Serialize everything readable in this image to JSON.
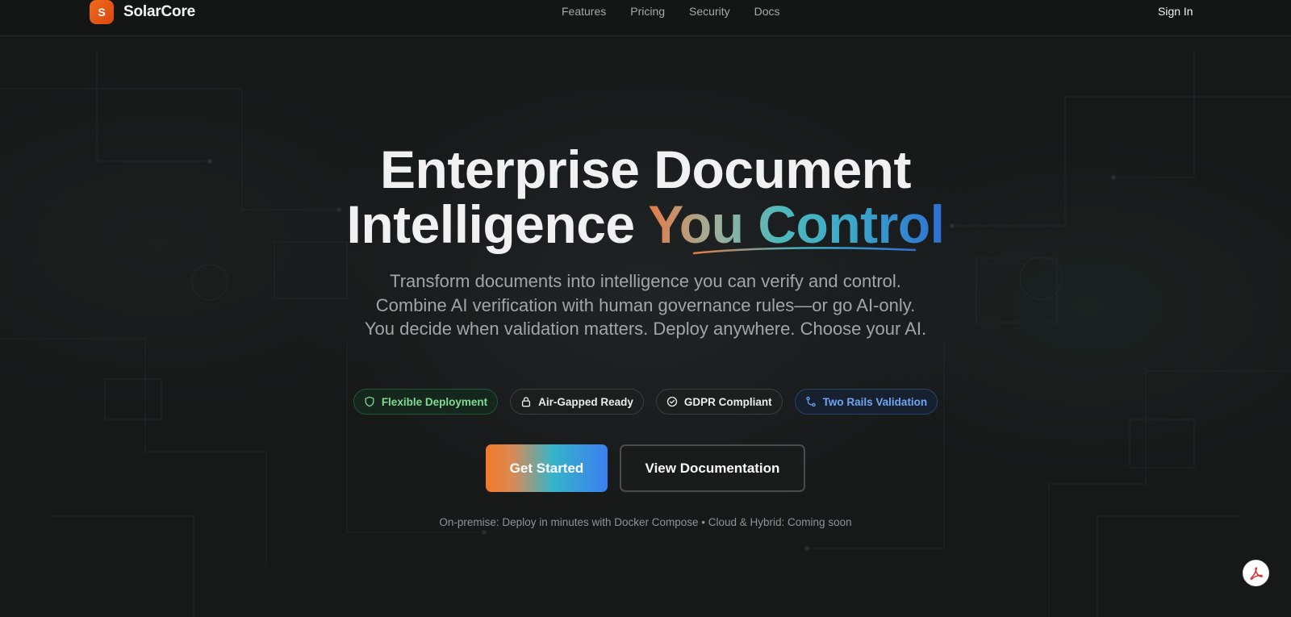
{
  "header": {
    "logo_letter": "S",
    "brand": "SolarCore",
    "nav": [
      "Features",
      "Pricing",
      "Security",
      "Docs"
    ],
    "sign_in": "Sign In"
  },
  "hero": {
    "title_line1": "Enterprise Document",
    "title_line2_plain": "Intelligence ",
    "title_line2_accent": "You Control",
    "subtitle": "Transform documents into intelligence you can verify and control. Combine AI verification with human governance rules—or go AI-only. You decide when validation matters. Deploy anywhere. Choose your AI.",
    "badges": [
      {
        "label": "Flexible Deployment",
        "icon": "shield-icon",
        "color": "#7fdc95"
      },
      {
        "label": "Air-Gapped Ready",
        "icon": "lock-icon",
        "color": "#ececec"
      },
      {
        "label": "GDPR Compliant",
        "icon": "check-circle-icon",
        "color": "#ececec"
      },
      {
        "label": "Two Rails Validation",
        "icon": "git-branch-icon",
        "color": "#6ea6f2"
      }
    ],
    "primary_cta": "Get Started",
    "secondary_cta": "View Documentation",
    "footnote": "On-premise: Deploy in minutes with Docker Compose • Cloud & Hybrid: Coming soon"
  },
  "floating": {
    "icon": "pdf-icon"
  },
  "colors": {
    "background": "#171919",
    "brand_orange": "#f06a1d",
    "accent_blue": "#3b7ff0",
    "accent_teal": "#36b4c9"
  }
}
